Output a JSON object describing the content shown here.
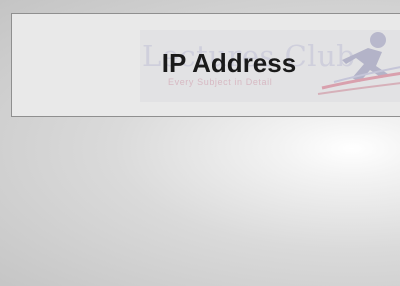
{
  "page": {
    "title": "IP Address"
  },
  "watermark": {
    "title": "Lectures Club",
    "tagline": "Every Subject in Detail"
  }
}
